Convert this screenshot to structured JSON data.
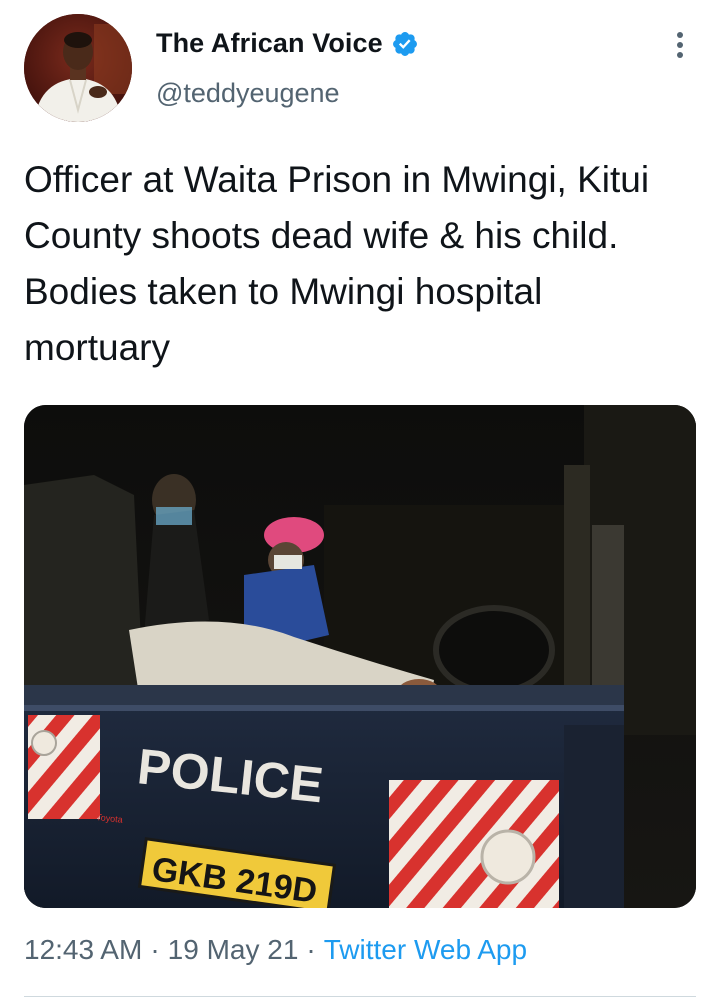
{
  "author": {
    "display_name": "The African Voice",
    "handle": "@teddyeugene",
    "verified": true,
    "avatar_icon": "avatar-man-white-shirt"
  },
  "tweet": {
    "text": "Officer at Waita Prison in Mwingi, Kitui County shoots dead wife & his child. Bodies taken to Mwingi hospital mortuary",
    "media": {
      "vehicle_door_label": "POLICE",
      "plate": "GKB 219D",
      "dealer_badge": "Toyota"
    }
  },
  "meta": {
    "time": "12:43 AM",
    "separator": "·",
    "date": "19 May 21",
    "source": "Twitter Web App"
  },
  "colors": {
    "verified_blue": "#1d9bf0",
    "link_blue": "#1d9bf0",
    "secondary_text": "#536471"
  },
  "icons": {
    "more": "more-vertical-icon",
    "verified": "verified-badge-icon"
  }
}
